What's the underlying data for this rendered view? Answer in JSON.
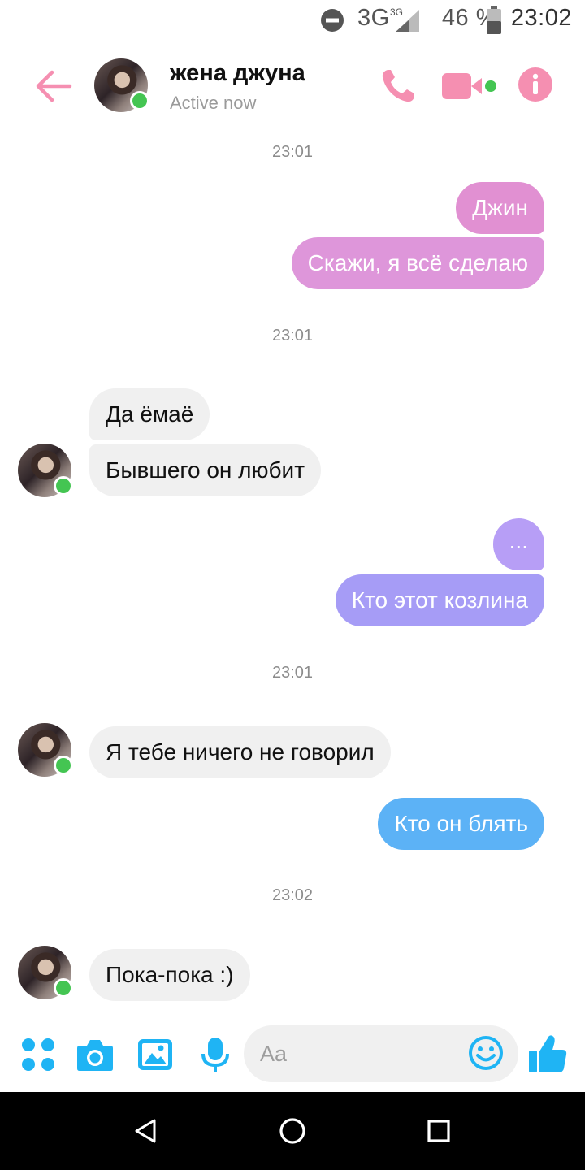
{
  "status_bar": {
    "network": "3G",
    "network_small": "3G",
    "battery": "46 %",
    "time": "23:02"
  },
  "header": {
    "contact_name": "жена джуна",
    "contact_status": "Active now"
  },
  "messages": [
    {
      "type": "timestamp",
      "text": "23:01"
    },
    {
      "type": "outgoing",
      "text": "Джин"
    },
    {
      "type": "outgoing",
      "text": "Скажи, я всё сделаю"
    },
    {
      "type": "timestamp",
      "text": "23:01"
    },
    {
      "type": "incoming",
      "text": "Да ёмаё"
    },
    {
      "type": "incoming",
      "text": "Бывшего он любит"
    },
    {
      "type": "outgoing",
      "text": "..."
    },
    {
      "type": "outgoing",
      "text": "Кто этот козлина"
    },
    {
      "type": "timestamp",
      "text": "23:01"
    },
    {
      "type": "incoming",
      "text": "Я тебе ничего не говорил"
    },
    {
      "type": "outgoing",
      "text": "Кто он блять"
    },
    {
      "type": "timestamp",
      "text": "23:02"
    },
    {
      "type": "incoming",
      "text": "Пока-пока :)"
    }
  ],
  "composer": {
    "placeholder": "Aa"
  },
  "colors": {
    "accent_pink": "#f58fb1",
    "messenger_blue": "#1fb4f4",
    "online_green": "#44c552",
    "incoming_bg": "#f0f0f0"
  },
  "icons": [
    "back-arrow-icon",
    "phone-icon",
    "video-camera-icon",
    "info-icon",
    "apps-icon",
    "camera-icon",
    "image-icon",
    "microphone-icon",
    "emoji-icon",
    "thumbs-up-icon",
    "nav-back-icon",
    "nav-home-icon",
    "nav-recents-icon"
  ]
}
